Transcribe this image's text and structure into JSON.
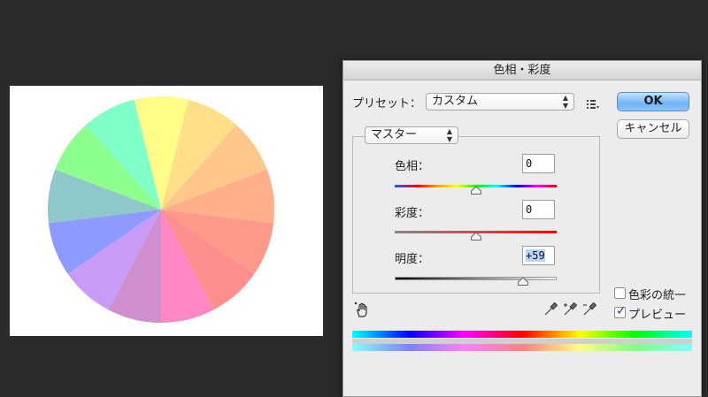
{
  "dialog": {
    "title": "色相・彩度",
    "preset_label": "プリセット：",
    "preset_value": "カスタム",
    "ok_label": "OK",
    "cancel_label": "キャンセル",
    "channel_value": "マスター",
    "hue": {
      "label": "色相：",
      "value": "0",
      "level": 0.5
    },
    "saturation": {
      "label": "彩度：",
      "value": "0",
      "level": 0.5
    },
    "lightness": {
      "label": "明度：",
      "value": "+59",
      "level": 0.79
    },
    "colorize": {
      "label": "色彩の統一",
      "checked": false
    },
    "preview": {
      "label": "プレビュー",
      "checked": true
    }
  },
  "icons": {
    "preset_menu": "list-options-icon",
    "on_image_adjust": "hand-adjust-icon",
    "eyedropper": "eyedropper-icon",
    "eyedropper_plus": "eyedropper-plus-icon",
    "eyedropper_minus": "eyedropper-minus-icon"
  },
  "colors": {
    "wheel_segments": [
      "#ffff88",
      "#ffdf8a",
      "#ffc88a",
      "#ffb08a",
      "#ff9a8a",
      "#ff8f8f",
      "#ff88c4",
      "#cf8fcf",
      "#c89bf6",
      "#8e9aff",
      "#8ec8c8",
      "#8cff8c",
      "#80ffc8"
    ],
    "accent": "#6eb5f4"
  }
}
